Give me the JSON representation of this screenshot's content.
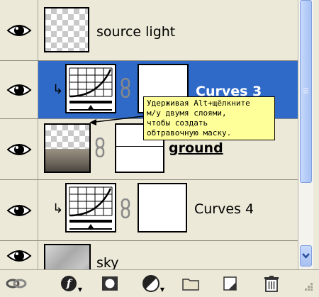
{
  "layers": [
    {
      "name": "source light",
      "type": "pixel",
      "visible_icon": "eye-icon"
    },
    {
      "name": "Curves 3",
      "type": "adjustment-curves",
      "selected": true,
      "visible_icon": "eye-icon"
    },
    {
      "name": "ground",
      "type": "pixel-with-mask",
      "visible_icon": "eye-icon"
    },
    {
      "name": "Curves 4",
      "type": "adjustment-curves",
      "visible_icon": "eye-icon"
    },
    {
      "name": "sky",
      "type": "pixel",
      "visible_icon": "eye-icon"
    }
  ],
  "tooltip": {
    "line1": "Удерживая Alt+щёлкните",
    "line2": "м/у двумя слоями,",
    "line3": "чтобы создать",
    "line4": "обтравочную маску."
  },
  "toolbar": {
    "icons": [
      "link-layers-icon",
      "layer-style-icon",
      "add-mask-icon",
      "adjustment-layer-icon",
      "new-group-icon",
      "new-layer-icon",
      "delete-icon"
    ]
  },
  "colors": {
    "panel_bg": "#ece9d8",
    "selection": "#2f6ac8",
    "tooltip_bg": "#ffff99",
    "scrollbar": "#b6cdf7"
  }
}
